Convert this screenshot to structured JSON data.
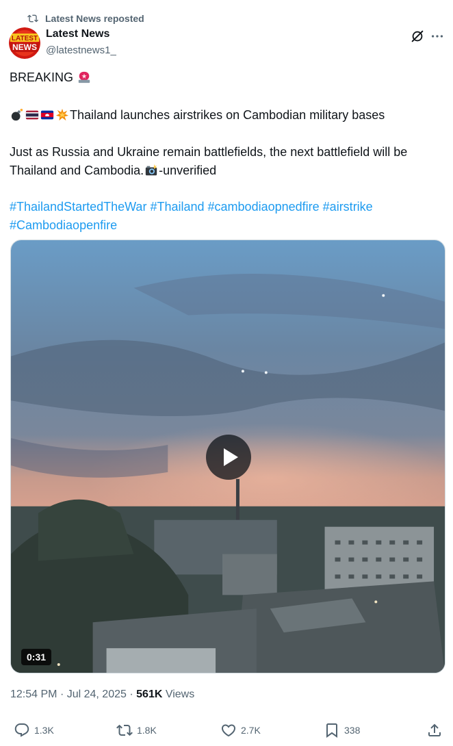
{
  "repost_label": "Latest News reposted",
  "author": {
    "name": "Latest News",
    "handle": "@latestnews1_",
    "avatar_text_top": "LATEST",
    "avatar_text_bottom": "NEWS"
  },
  "post": {
    "line1": "BREAKING",
    "line2": "Thailand launches airstrikes on Cambodian military bases",
    "line3": "Just as Russia and Ukraine remain battlefields, the next battlefield will be Thailand and Cambodia.",
    "line3_suffix": "-unverified",
    "hashtags": [
      "#ThailandStartedTheWar",
      "#Thailand",
      "#cambodiaopnedfire",
      "#airstrike",
      "#Cambodiaopenfire"
    ]
  },
  "video": {
    "duration": "0:31"
  },
  "meta": {
    "time": "12:54 PM",
    "date": "Jul 24, 2025",
    "separator": "·",
    "views_count": "561K",
    "views_label": "Views"
  },
  "actions": {
    "replies": "1.3K",
    "reposts": "1.8K",
    "likes": "2.7K",
    "bookmarks": "338"
  },
  "colors": {
    "accent": "#1d9bf0",
    "secondary_text": "#536471",
    "primary_text": "#0f1419"
  },
  "icons": [
    "repost-icon",
    "grok-icon",
    "more-icon",
    "siren-emoji",
    "bomb-emoji",
    "thai-flag-emoji",
    "cambodia-flag-emoji",
    "explosion-emoji",
    "camera-flash-emoji",
    "play-icon",
    "reply-icon",
    "like-icon",
    "bookmark-icon",
    "share-icon"
  ]
}
